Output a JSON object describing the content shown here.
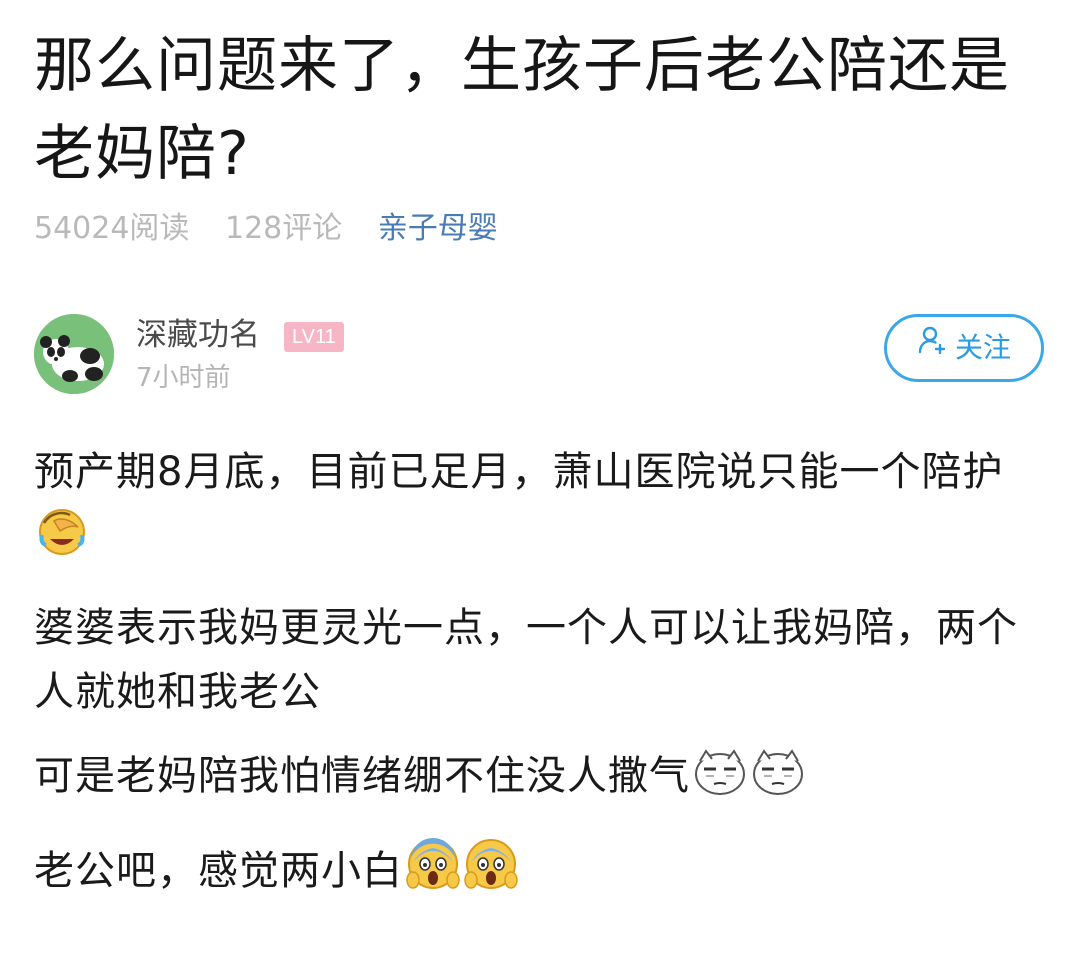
{
  "article": {
    "title": "那么问题来了，生孩子后老公陪还是老妈陪?",
    "reads": "54024阅读",
    "comments": "128评论",
    "category": "亲子母婴"
  },
  "author": {
    "name": "深藏功名",
    "level": "LV11",
    "time": "7小时前",
    "avatar_icon": "panda-avatar",
    "follow_label": "关注",
    "follow_icon": "add-user-icon"
  },
  "colors": {
    "accent": "#3aa8e8",
    "category": "#4a7bb5",
    "level_badge": "#f6b6c6",
    "avatar_bg": "#79c17a"
  },
  "body": {
    "p1": "预产期8月底，目前已足月，萧山医院说只能一个陪护",
    "p1_emoji": "crying-laughing-emoji",
    "p2": "婆婆表示我妈更灵光一点，一个人可以让我妈陪，两个人就她和我老公",
    "p3": "可是老妈陪我怕情绪绷不住没人撒气",
    "p3_emoji": "smirk-face-emoji",
    "p4": "老公吧，感觉两小白",
    "p4_emoji": "screaming-face-emoji"
  }
}
